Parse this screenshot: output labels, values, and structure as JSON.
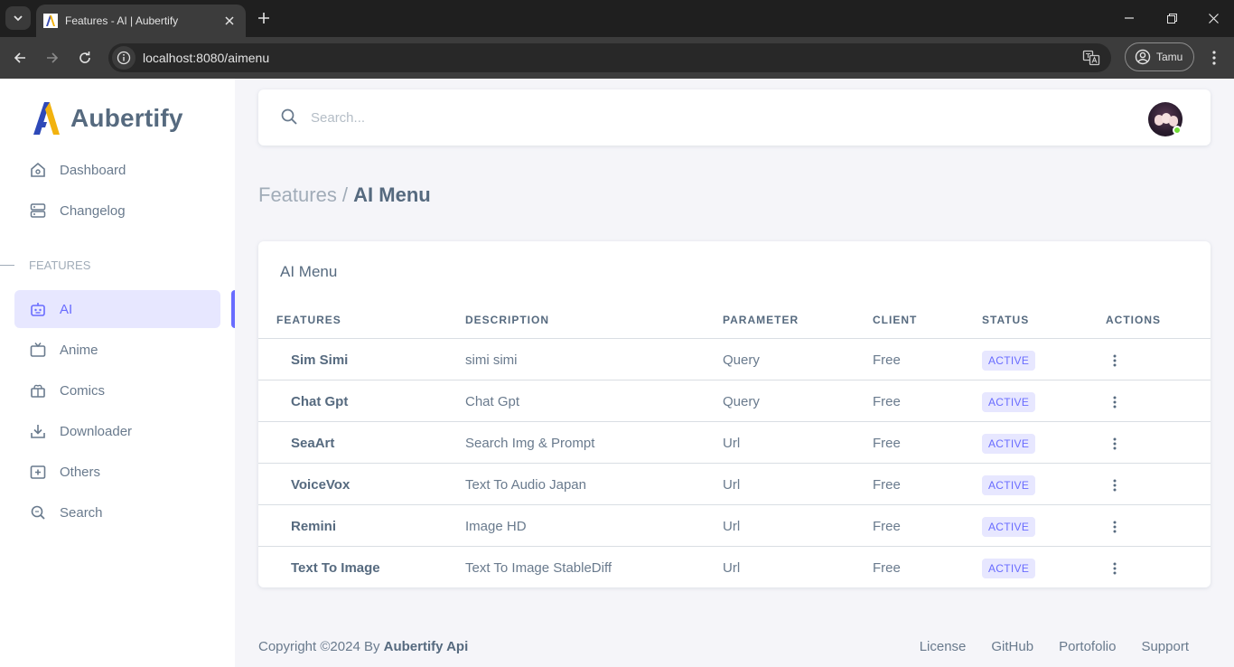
{
  "browser": {
    "tab_title": "Features - AI | Aubertify",
    "url_host": "localhost",
    "url_rest": ":8080/aimenu",
    "profile_name": "Tamu"
  },
  "sidebar": {
    "brand": "Aubertify",
    "top_items": [
      {
        "label": "Dashboard",
        "icon": "home-icon"
      },
      {
        "label": "Changelog",
        "icon": "server-icon"
      }
    ],
    "section_header": "FEATURES",
    "items": [
      {
        "label": "AI",
        "icon": "bot-icon",
        "active": true
      },
      {
        "label": "Anime",
        "icon": "tv-icon"
      },
      {
        "label": "Comics",
        "icon": "book-icon"
      },
      {
        "label": "Downloader",
        "icon": "download-icon"
      },
      {
        "label": "Others",
        "icon": "plus-box-icon"
      },
      {
        "label": "Search",
        "icon": "search-icon"
      }
    ]
  },
  "navbar": {
    "search_placeholder": "Search..."
  },
  "breadcrumb": {
    "parent": "Features /",
    "current": "AI Menu"
  },
  "card": {
    "title": "AI Menu",
    "columns": [
      "FEATURES",
      "DESCRIPTION",
      "PARAMETER",
      "CLIENT",
      "STATUS",
      "ACTIONS"
    ],
    "rows": [
      {
        "feature": "Sim Simi",
        "description": "simi simi",
        "parameter": "Query",
        "client": "Free",
        "status": "ACTIVE"
      },
      {
        "feature": "Chat Gpt",
        "description": "Chat Gpt",
        "parameter": "Query",
        "client": "Free",
        "status": "ACTIVE"
      },
      {
        "feature": "SeaArt",
        "description": "Search Img & Prompt",
        "parameter": "Url",
        "client": "Free",
        "status": "ACTIVE"
      },
      {
        "feature": "VoiceVox",
        "description": "Text To Audio Japan",
        "parameter": "Url",
        "client": "Free",
        "status": "ACTIVE"
      },
      {
        "feature": "Remini",
        "description": "Image HD",
        "parameter": "Url",
        "client": "Free",
        "status": "ACTIVE"
      },
      {
        "feature": "Text To Image",
        "description": "Text To Image StableDiff",
        "parameter": "Url",
        "client": "Free",
        "status": "ACTIVE"
      }
    ]
  },
  "footer": {
    "copyright": "Copyright ©2024 By ",
    "brand": "Aubertify Api",
    "links": [
      "License",
      "GitHub",
      "Portofolio",
      "Support"
    ]
  },
  "colors": {
    "accent": "#696cff",
    "accent_light": "#e7e7ff",
    "text": "#566a7f",
    "online": "#71dd37"
  }
}
